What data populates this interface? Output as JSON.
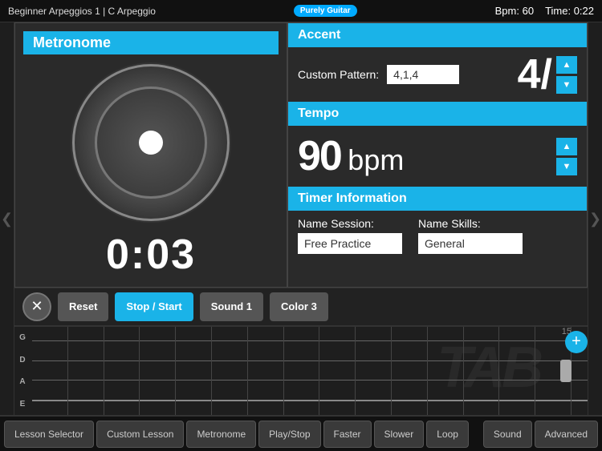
{
  "header": {
    "title": "Beginner Arpeggios 1 | C Arpeggio",
    "logo_text": "Purely Guitar",
    "bpm_label": "Bpm: 60",
    "time_label": "Time: 0:22"
  },
  "metronome": {
    "panel_title": "Metronome",
    "timer_display": "0:03"
  },
  "accent": {
    "section_title": "Accent",
    "custom_pattern_label": "Custom Pattern:",
    "custom_pattern_value": "4,1,4",
    "fraction_value": "4/"
  },
  "tempo": {
    "section_title": "Tempo",
    "value": "90",
    "unit": "bpm"
  },
  "timer_info": {
    "section_title": "Timer Information",
    "name_session_label": "Name Session:",
    "name_skills_label": "Name Skills:",
    "session_value": "Free Practice",
    "skills_value": "General"
  },
  "controls": {
    "close_label": "✕",
    "reset_label": "Reset",
    "stop_start_label": "Stop / Start",
    "sound1_label": "Sound 1",
    "color3_label": "Color 3"
  },
  "strings": [
    "G",
    "D",
    "A",
    "E"
  ],
  "fret_number": "15",
  "nav": {
    "left_arrow": "❮",
    "right_arrow": "❯"
  },
  "footer": {
    "lesson_selector": "Lesson Selector",
    "custom_lesson": "Custom Lesson",
    "metronome": "Metronome",
    "play_stop": "Play/Stop",
    "faster": "Faster",
    "slower": "Slower",
    "loop": "Loop",
    "sound": "Sound",
    "advanced": "Advanced"
  },
  "arrows": {
    "up": "▲",
    "down": "▼"
  }
}
